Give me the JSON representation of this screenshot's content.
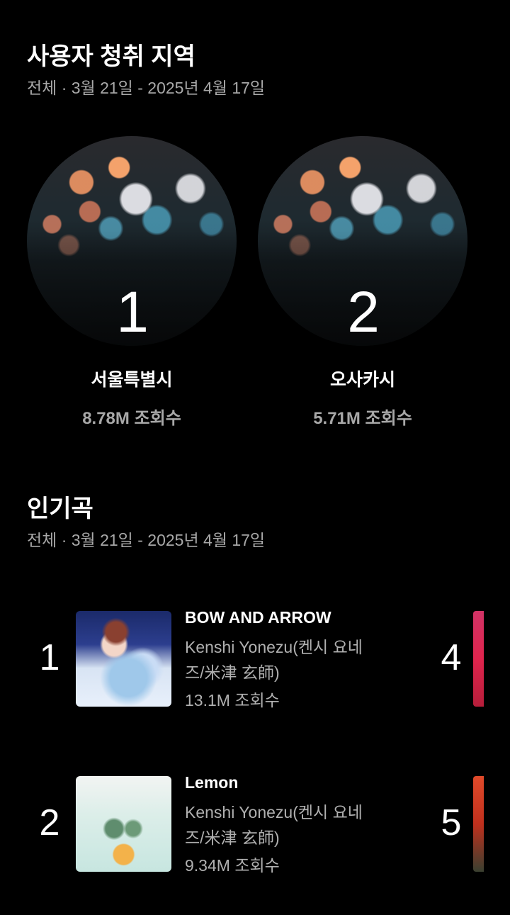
{
  "regions_section": {
    "title": "사용자 청취 지역",
    "subtitle": "전체 · 3월 21일 - 2025년 4월 17일",
    "items": [
      {
        "rank": "1",
        "name": "서울특별시",
        "views": "8.78M 조회수"
      },
      {
        "rank": "2",
        "name": "오사카시",
        "views": "5.71M 조회수"
      }
    ]
  },
  "songs_section": {
    "title": "인기곡",
    "subtitle": "전체 · 3월 21일 - 2025년 4월 17일",
    "items": [
      {
        "rank": "1",
        "title": "BOW AND ARROW",
        "artist": "Kenshi Yonezu(켄시 요네즈/米津 玄師)",
        "artist_line1": "Kenshi Yonezu(켄시 요네",
        "artist_line2": "즈/米津 玄師)",
        "views": "13.1M 조회수"
      },
      {
        "rank": "2",
        "title": "Lemon",
        "artist": "Kenshi Yonezu(켄시 요네즈/米津 玄師)",
        "artist_line1": "Kenshi Yonezu(켄시 요네",
        "artist_line2": "즈/米津 玄師)",
        "views": "9.34M 조회수"
      }
    ],
    "peek": [
      {
        "rank": "4"
      },
      {
        "rank": "5"
      }
    ]
  }
}
